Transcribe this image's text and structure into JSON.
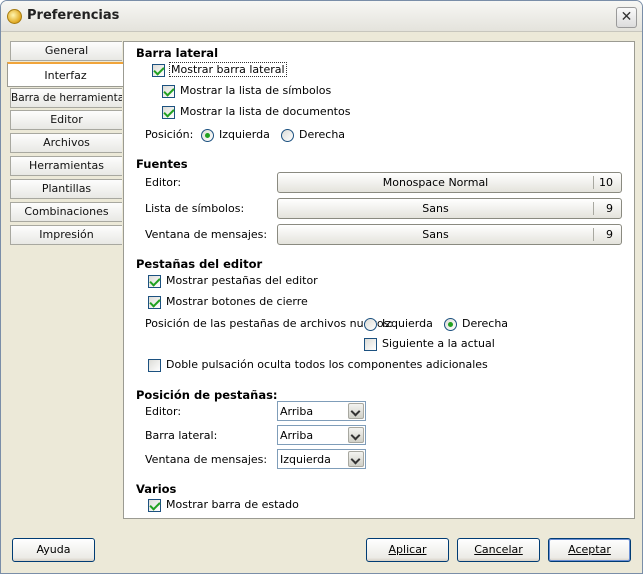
{
  "window": {
    "title": "Preferencias",
    "close_label": "✕"
  },
  "tabs": [
    "General",
    "Interfaz",
    "Barra de herramientas",
    "Editor",
    "Archivos",
    "Herramientas",
    "Plantillas",
    "Combinaciones",
    "Impresión"
  ],
  "active_tab": "Interfaz",
  "sidebar": {
    "title": "Barra lateral",
    "show_sidebar": "Mostrar barra lateral",
    "show_symbols": "Mostrar la lista de símbolos",
    "show_documents": "Mostrar la lista de documentos",
    "position_label": "Posición:",
    "left": "Izquierda",
    "right": "Derecha"
  },
  "fonts": {
    "title": "Fuentes",
    "editor_label": "Editor:",
    "editor_font": "Monospace Normal",
    "editor_size": "10",
    "symbols_label": "Lista de símbolos:",
    "symbols_font": "Sans",
    "symbols_size": "9",
    "messages_label": "Ventana de mensajes:",
    "messages_font": "Sans",
    "messages_size": "9"
  },
  "editor_tabs": {
    "title": "Pestañas del editor",
    "show_tabs": "Mostrar pestañas del editor",
    "show_close": "Mostrar botones de cierre",
    "new_tabs_position": "Posición de las pestañas de archivos nuevos:",
    "left": "Izquierda",
    "right": "Derecha",
    "next_to_current": "Siguiente a la actual",
    "double_click": "Doble pulsación oculta todos los componentes adicionales"
  },
  "tab_positions": {
    "title": "Posición de pestañas:",
    "editor_label": "Editor:",
    "editor_value": "Arriba",
    "sidebar_label": "Barra lateral:",
    "sidebar_value": "Arriba",
    "messages_label": "Ventana de mensajes:",
    "messages_value": "Izquierda"
  },
  "misc": {
    "title": "Varios",
    "show_statusbar": "Mostrar barra de estado"
  },
  "buttons": {
    "help": "Ayuda",
    "apply": "Aplicar",
    "cancel": "Cancelar",
    "accept": "Aceptar"
  },
  "colors": {
    "check_green": "#21a121",
    "tab_highlight": "#f0a43a",
    "window_bg": "#ece9d8"
  }
}
